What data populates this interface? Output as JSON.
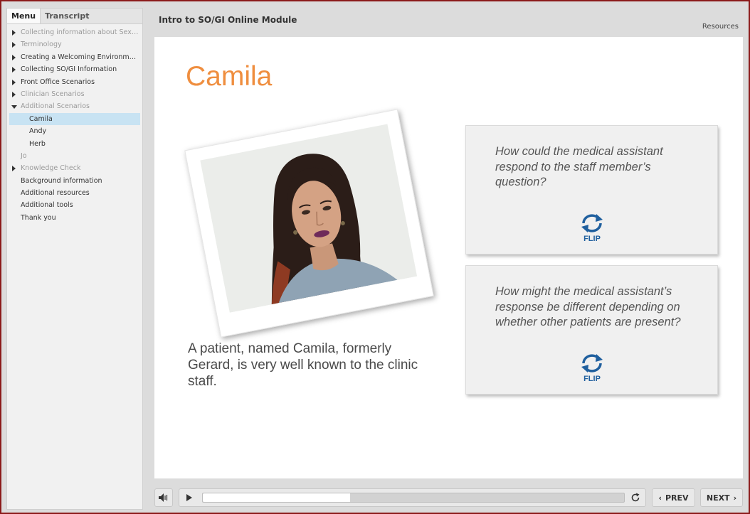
{
  "sidebar": {
    "tabs": [
      {
        "label": "Menu",
        "active": true
      },
      {
        "label": "Transcript",
        "active": false
      }
    ],
    "items": [
      {
        "label": "Collecting information about Sexual...",
        "level": 0,
        "caret": "closed",
        "muted": true
      },
      {
        "label": "Terminology",
        "level": 0,
        "caret": "closed",
        "muted": true
      },
      {
        "label": "Creating a Welcoming Environment",
        "level": 0,
        "caret": "closed",
        "muted": false
      },
      {
        "label": "Collecting SO/GI Information",
        "level": 0,
        "caret": "closed",
        "muted": false
      },
      {
        "label": "Front Office Scenarios",
        "level": 0,
        "caret": "closed",
        "muted": false
      },
      {
        "label": "Clinician Scenarios",
        "level": 0,
        "caret": "closed",
        "muted": true
      },
      {
        "label": "Additional Scenarios",
        "level": 0,
        "caret": "open",
        "muted": true
      },
      {
        "label": "Camila",
        "level": 1,
        "caret": "none",
        "muted": false,
        "selected": true
      },
      {
        "label": "Andy",
        "level": 1,
        "caret": "none",
        "muted": false
      },
      {
        "label": "Herb",
        "level": 1,
        "caret": "none",
        "muted": false
      },
      {
        "label": "Jo",
        "level": 0,
        "caret": "none",
        "muted": true
      },
      {
        "label": "Knowledge Check",
        "level": 0,
        "caret": "closed",
        "muted": true
      },
      {
        "label": "Background information",
        "level": 0,
        "caret": "none",
        "muted": false
      },
      {
        "label": "Additional resources",
        "level": 0,
        "caret": "none",
        "muted": false
      },
      {
        "label": "Additional tools",
        "level": 0,
        "caret": "none",
        "muted": false
      },
      {
        "label": "Thank you",
        "level": 0,
        "caret": "none",
        "muted": false
      }
    ]
  },
  "header": {
    "title": "Intro to SO/GI Online Module",
    "resources_label": "Resources"
  },
  "slide": {
    "title": "Camila",
    "intro_text": "A patient, named Camila, formerly Gerard, is very well known to the clinic staff.",
    "cards": [
      {
        "question": "How could the medical assistant respond to the staff member’s question?",
        "flip_label": "FLIP"
      },
      {
        "question": "How might the medical assistant’s response be different depending on whether other patients are present?",
        "flip_label": "FLIP"
      }
    ]
  },
  "controls": {
    "prev_label": "PREV",
    "next_label": "NEXT",
    "progress": 0.35,
    "volume_icon": "speaker-icon",
    "play_icon": "play-icon",
    "replay_icon": "replay-icon"
  },
  "colors": {
    "accent_title": "#ef8e3f",
    "flip_blue": "#1f5f9e",
    "selected_menu": "#c8e3f3",
    "frame_border": "#8b1a1a"
  }
}
